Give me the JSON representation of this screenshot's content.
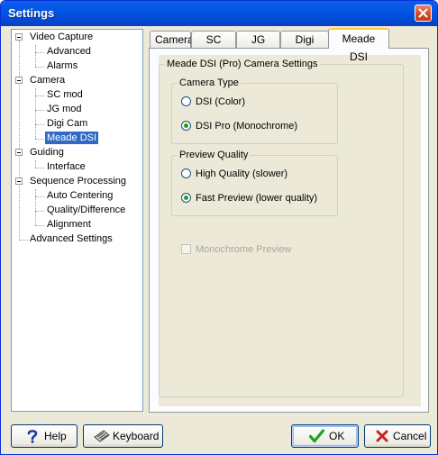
{
  "window": {
    "title": "Settings"
  },
  "tree": {
    "nodes": [
      {
        "label": "Video Capture"
      },
      {
        "label": "Advanced"
      },
      {
        "label": "Alarms"
      },
      {
        "label": "Camera"
      },
      {
        "label": "SC mod"
      },
      {
        "label": "JG mod"
      },
      {
        "label": "Digi Cam"
      },
      {
        "label": "Meade DSI"
      },
      {
        "label": "Guiding"
      },
      {
        "label": "Interface"
      },
      {
        "label": "Sequence Processing"
      },
      {
        "label": "Auto Centering"
      },
      {
        "label": "Quality/Difference"
      },
      {
        "label": "Alignment"
      },
      {
        "label": "Advanced Settings"
      }
    ],
    "selected": "Meade DSI"
  },
  "tabs": [
    {
      "label": "Camera"
    },
    {
      "label": "SC mod"
    },
    {
      "label": "JG mod"
    },
    {
      "label": "Digi Cam"
    },
    {
      "label": "Meade DSI"
    }
  ],
  "active_tab": "Meade DSI",
  "panel": {
    "group_title": "Meade DSI (Pro) Camera Settings",
    "camera_type": {
      "title": "Camera Type",
      "options": [
        {
          "label": "DSI (Color)",
          "checked": false
        },
        {
          "label": "DSI Pro (Monochrome)",
          "checked": true
        }
      ]
    },
    "preview_quality": {
      "title": "Preview Quality",
      "options": [
        {
          "label": "High Quality (slower)",
          "checked": false
        },
        {
          "label": "Fast Preview (lower quality)",
          "checked": true
        }
      ]
    },
    "monochrome_preview": {
      "label": "Monochrome Preview",
      "checked": false,
      "enabled": false
    }
  },
  "buttons": {
    "help": "Help",
    "keyboard": "Keyboard",
    "ok": "OK",
    "cancel": "Cancel"
  },
  "colors": {
    "title_bar": "#0054e3",
    "selection": "#316ac5",
    "tab_highlight": "#ffc83c",
    "ok_check": "#21a121",
    "cancel_x": "#c0281c"
  }
}
